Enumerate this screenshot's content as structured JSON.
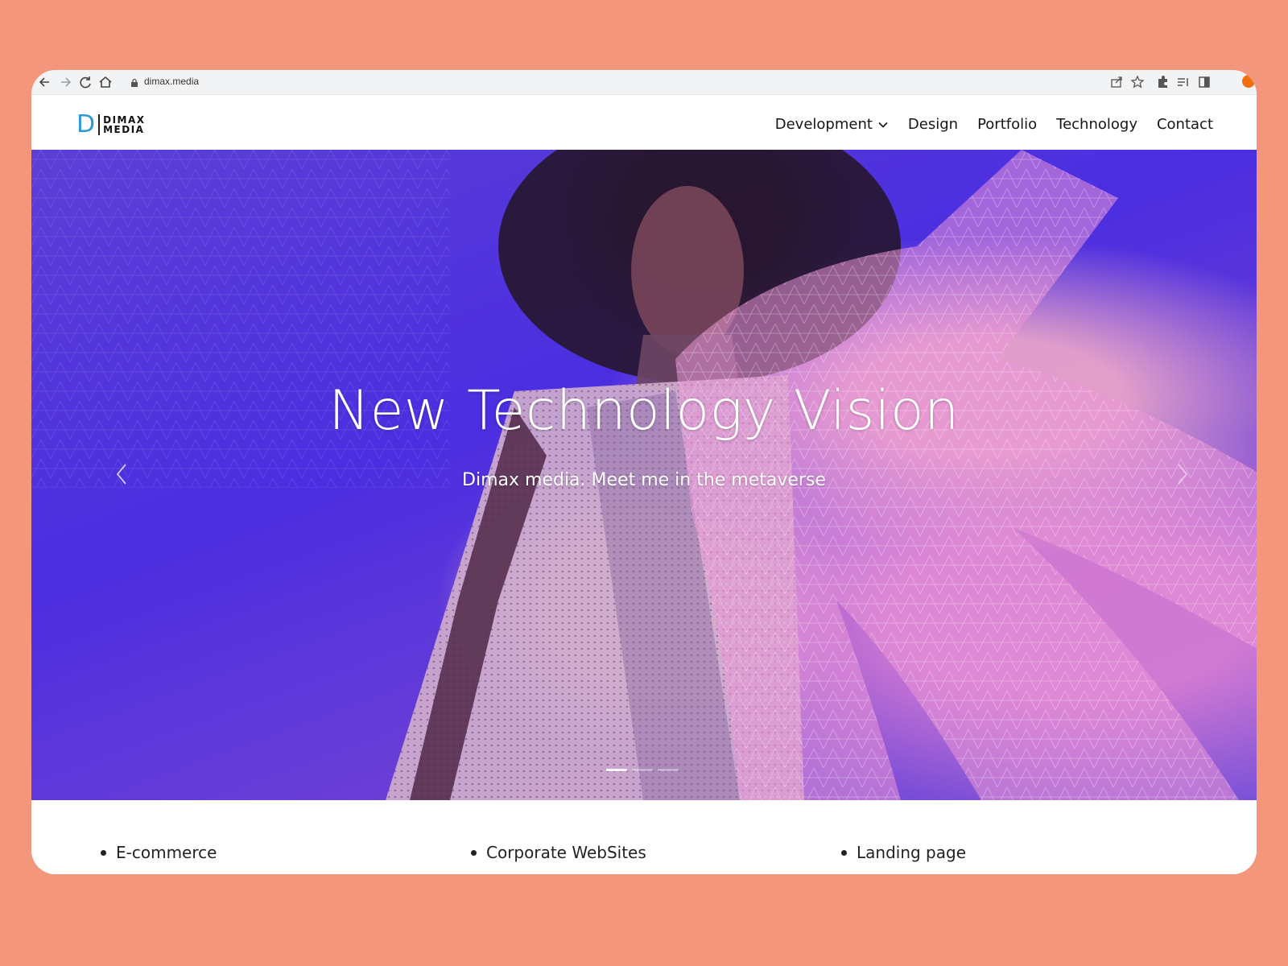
{
  "browser": {
    "url": "dimax.media"
  },
  "site": {
    "logo": {
      "mark": "D",
      "line1": "DIMAX",
      "line2": "MEDIA"
    },
    "nav": [
      {
        "label": "Development",
        "has_dropdown": true
      },
      {
        "label": "Design"
      },
      {
        "label": "Portfolio"
      },
      {
        "label": "Technology"
      },
      {
        "label": "Contact"
      }
    ]
  },
  "hero": {
    "title": "New Technology Vision",
    "subtitle": "Dimax media. Meet me in the metaverse",
    "slides_count": 3,
    "active_slide": 1
  },
  "services": [
    "E-commerce",
    "Corporate WebSites",
    "Landing page"
  ],
  "colors": {
    "page_background": "#f4967c",
    "logo_accent": "#2d9bd5",
    "hero_base": "#4b2ee0"
  }
}
